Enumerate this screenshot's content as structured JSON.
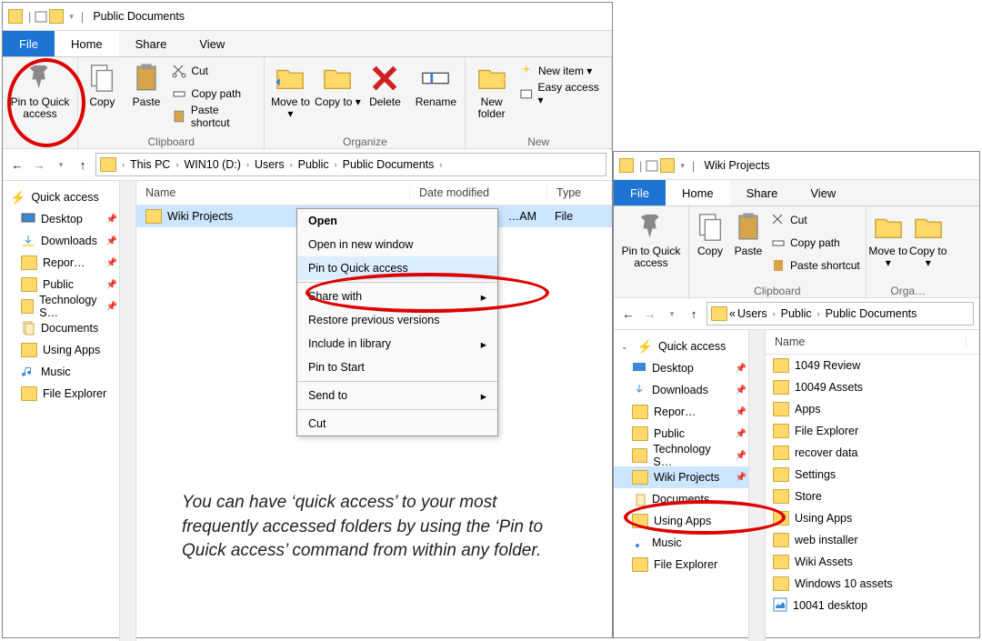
{
  "win1": {
    "title": "Public Documents",
    "tabs": {
      "file": "File",
      "home": "Home",
      "share": "Share",
      "view": "View"
    },
    "ribbon": {
      "pin": "Pin to Quick access",
      "copy": "Copy",
      "paste": "Paste",
      "cut": "Cut",
      "copypath": "Copy path",
      "pasteshort": "Paste shortcut",
      "clipboard_lbl": "Clipboard",
      "moveto": "Move to ▾",
      "copyto": "Copy to ▾",
      "delete": "Delete",
      "rename": "Rename",
      "organize_lbl": "Organize",
      "newfolder": "New folder",
      "newitem": "New item ▾",
      "easyaccess": "Easy access ▾",
      "new_lbl": "New"
    },
    "crumbs": [
      "This PC",
      "WIN10 (D:)",
      "Users",
      "Public",
      "Public Documents"
    ],
    "columns": {
      "name": "Name",
      "date": "Date modified",
      "type": "Type"
    },
    "qa_lbl": "Quick access",
    "qa": [
      "Desktop",
      "Downloads",
      "Repor…",
      "Public",
      "Technology S…",
      "Documents",
      "Using Apps",
      "Music",
      "File Explorer"
    ],
    "filerow": {
      "name": "Wiki Projects",
      "date": "…AM",
      "type": "File"
    },
    "ctx": {
      "open": "Open",
      "opennew": "Open in new window",
      "pin": "Pin to Quick access",
      "share": "Share with",
      "restore": "Restore previous versions",
      "include": "Include in library",
      "pinstart": "Pin to Start",
      "sendto": "Send to",
      "cut": "Cut"
    }
  },
  "win2": {
    "title": "Wiki Projects",
    "tabs": {
      "file": "File",
      "home": "Home",
      "share": "Share",
      "view": "View"
    },
    "ribbon": {
      "pin": "Pin to Quick access",
      "copy": "Copy",
      "paste": "Paste",
      "cut": "Cut",
      "copypath": "Copy path",
      "pasteshort": "Paste shortcut",
      "clipboard_lbl": "Clipboard",
      "moveto": "Move to ▾",
      "copyto": "Copy to ▾",
      "organize_lbl": "Orga…"
    },
    "crumbs_prefix": "«",
    "crumbs": [
      "Users",
      "Public",
      "Public Documents"
    ],
    "columns": {
      "name": "Name"
    },
    "qa_lbl": "Quick access",
    "qa": [
      "Desktop",
      "Downloads",
      "Repor…",
      "Public",
      "Technology S…",
      "Wiki Projects",
      "Documents",
      "Using Apps",
      "Music",
      "File Explorer"
    ],
    "files": [
      "1049 Review",
      "10049 Assets",
      "Apps",
      "File Explorer",
      "recover data",
      "Settings",
      "Store",
      "Using Apps",
      "web installer",
      "Wiki Assets",
      "Windows 10 assets",
      "10041 desktop"
    ]
  },
  "caption": "You can have ‘quick access’ to your most frequently accessed folders by using the ‘Pin to Quick access’ command from within any folder."
}
